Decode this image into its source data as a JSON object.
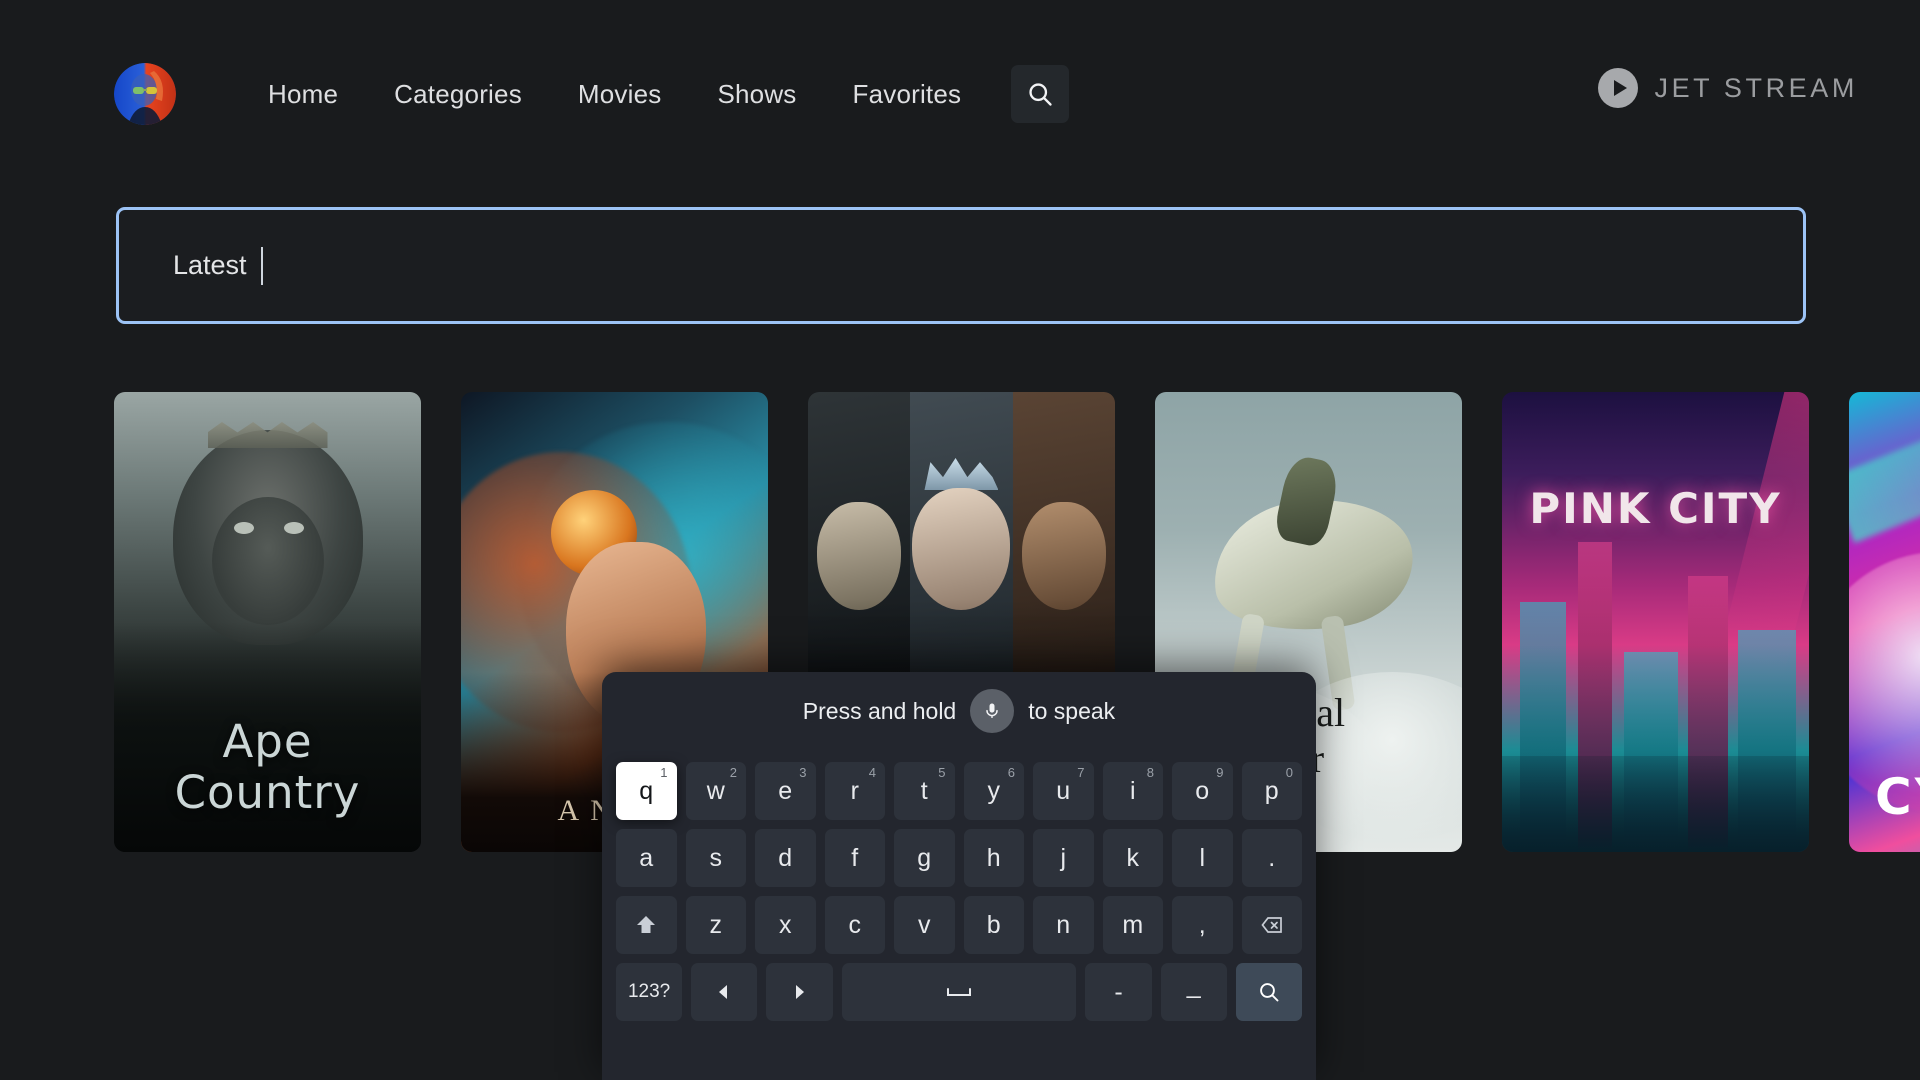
{
  "header": {
    "avatar_label": "user-avatar",
    "nav_items": [
      {
        "label": "Home",
        "name": "nav-home"
      },
      {
        "label": "Categories",
        "name": "nav-categories"
      },
      {
        "label": "Movies",
        "name": "nav-movies"
      },
      {
        "label": "Shows",
        "name": "nav-shows"
      },
      {
        "label": "Favorites",
        "name": "nav-favorites"
      }
    ],
    "search_icon": "search-icon",
    "brand": {
      "icon": "play-circle-icon",
      "text": "JET STREAM"
    }
  },
  "search": {
    "value": "Latest",
    "placeholder": "",
    "border_color": "#9cc3f5",
    "has_caret": true
  },
  "content": {
    "posters": [
      {
        "title": "Ape\nCountry",
        "line1": "Ape",
        "line2": "Country",
        "name": "poster-ape-country"
      },
      {
        "title": "ANTA",
        "line1": "ANTA",
        "line2": "",
        "name": "poster-fantasy"
      },
      {
        "title": "",
        "line1": "",
        "line2": "",
        "name": "poster-triptych"
      },
      {
        "title": "ortal\ner",
        "line1": "ortal",
        "line2": "er",
        "name": "poster-immortal-rider"
      },
      {
        "title": "PINK CITY",
        "line1": "PINK CITY",
        "line2": "",
        "name": "poster-pink-city"
      },
      {
        "title": "CY",
        "line1": "CY",
        "line2": "",
        "name": "poster-cy"
      }
    ]
  },
  "keyboard": {
    "speak_prompt_before": "Press and hold",
    "speak_prompt_after": "to speak",
    "mic_icon": "microphone-icon",
    "selected_key": "q",
    "rows": [
      {
        "name": "keyboard-row-1",
        "keys": [
          {
            "label": "q",
            "alt": "1",
            "selected": true
          },
          {
            "label": "w",
            "alt": "2",
            "selected": false
          },
          {
            "label": "e",
            "alt": "3",
            "selected": false
          },
          {
            "label": "r",
            "alt": "4",
            "selected": false
          },
          {
            "label": "t",
            "alt": "5",
            "selected": false
          },
          {
            "label": "y",
            "alt": "6",
            "selected": false
          },
          {
            "label": "u",
            "alt": "7",
            "selected": false
          },
          {
            "label": "i",
            "alt": "8",
            "selected": false
          },
          {
            "label": "o",
            "alt": "9",
            "selected": false
          },
          {
            "label": "p",
            "alt": "0",
            "selected": false
          }
        ]
      },
      {
        "name": "keyboard-row-2",
        "keys": [
          {
            "label": "a",
            "alt": "",
            "selected": false
          },
          {
            "label": "s",
            "alt": "",
            "selected": false
          },
          {
            "label": "d",
            "alt": "",
            "selected": false
          },
          {
            "label": "f",
            "alt": "",
            "selected": false
          },
          {
            "label": "g",
            "alt": "",
            "selected": false
          },
          {
            "label": "h",
            "alt": "",
            "selected": false
          },
          {
            "label": "j",
            "alt": "",
            "selected": false
          },
          {
            "label": "k",
            "alt": "",
            "selected": false
          },
          {
            "label": "l",
            "alt": "",
            "selected": false
          },
          {
            "label": ".",
            "alt": "",
            "selected": false
          }
        ]
      },
      {
        "name": "keyboard-row-3",
        "keys": [
          {
            "label": "",
            "icon": "shift-icon",
            "alt": "",
            "selected": false
          },
          {
            "label": "z",
            "alt": "",
            "selected": false
          },
          {
            "label": "x",
            "alt": "",
            "selected": false
          },
          {
            "label": "c",
            "alt": "",
            "selected": false
          },
          {
            "label": "v",
            "alt": "",
            "selected": false
          },
          {
            "label": "b",
            "alt": "",
            "selected": false
          },
          {
            "label": "n",
            "alt": "",
            "selected": false
          },
          {
            "label": "m",
            "alt": "",
            "selected": false
          },
          {
            "label": ",",
            "alt": "",
            "selected": false
          },
          {
            "label": "",
            "icon": "backspace-icon",
            "alt": "",
            "selected": false
          }
        ]
      },
      {
        "name": "keyboard-row-4",
        "keys": [
          {
            "label": "123?",
            "alt": "",
            "selected": false
          },
          {
            "label": "",
            "icon": "arrow-left-icon",
            "alt": "",
            "selected": false
          },
          {
            "label": "",
            "icon": "arrow-right-icon",
            "alt": "",
            "selected": false
          },
          {
            "label": "",
            "icon": "space-icon",
            "alt": "",
            "selected": false
          },
          {
            "label": "-",
            "alt": "",
            "selected": false
          },
          {
            "label": "_",
            "alt": "",
            "selected": false
          },
          {
            "label": "",
            "icon": "search-icon",
            "alt": "",
            "selected": false
          }
        ]
      }
    ]
  },
  "colors": {
    "background": "#191b1d",
    "keyboard_panel": "#23262e",
    "key": "#2d323b",
    "key_selected": "#ffffff",
    "key_accent": "#3e4a58",
    "focus_border": "#9cc3f5",
    "brand_text": "#9b9da0"
  }
}
